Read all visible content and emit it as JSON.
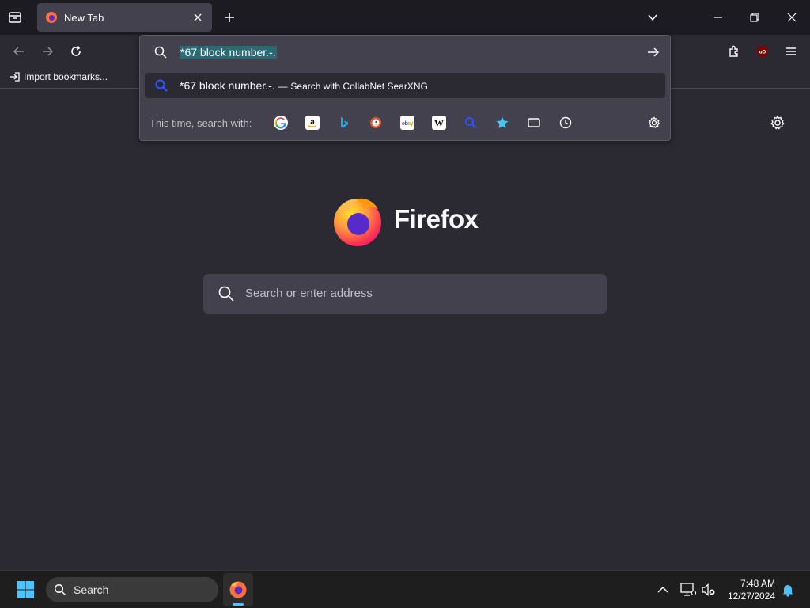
{
  "browser": {
    "tab": {
      "title": "New Tab"
    },
    "bookmarks_toolbar": {
      "import_label": "Import bookmarks..."
    },
    "address_bar": {
      "typed_value": "*67 block number.-.",
      "suggestion": {
        "query": "*67 block number.-.",
        "separator": "—",
        "action": "Search with CollabNet SearXNG"
      },
      "one_off": {
        "label": "This time, search with:",
        "engines": [
          "google-icon",
          "amazon-icon",
          "bing-icon",
          "duckduckgo-icon",
          "ebay-icon",
          "wikipedia-icon",
          "searxng-icon",
          "bookmarks-icon",
          "tabs-icon",
          "history-icon"
        ]
      }
    }
  },
  "newtab": {
    "brand": "Firefox",
    "search_placeholder": "Search or enter address"
  },
  "taskbar": {
    "search_label": "Search",
    "time": "7:48 AM",
    "date": "12/27/2024"
  },
  "colors": {
    "accent": "#2a6b73",
    "searx_blue": "#3050ff",
    "bg": "#2b2a33",
    "panel": "#42414d"
  }
}
